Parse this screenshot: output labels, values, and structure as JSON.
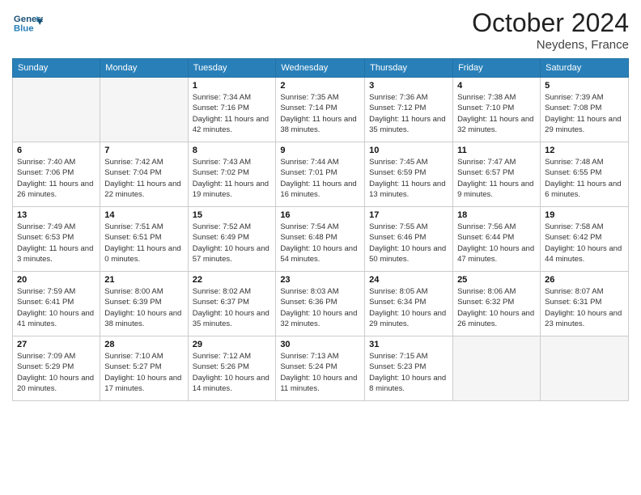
{
  "logo": {
    "general": "General",
    "blue": "Blue"
  },
  "header": {
    "month": "October 2024",
    "location": "Neydens, France"
  },
  "days_of_week": [
    "Sunday",
    "Monday",
    "Tuesday",
    "Wednesday",
    "Thursday",
    "Friday",
    "Saturday"
  ],
  "weeks": [
    [
      {
        "day": "",
        "info": ""
      },
      {
        "day": "",
        "info": ""
      },
      {
        "day": "1",
        "info": "Sunrise: 7:34 AM\nSunset: 7:16 PM\nDaylight: 11 hours and 42 minutes."
      },
      {
        "day": "2",
        "info": "Sunrise: 7:35 AM\nSunset: 7:14 PM\nDaylight: 11 hours and 38 minutes."
      },
      {
        "day": "3",
        "info": "Sunrise: 7:36 AM\nSunset: 7:12 PM\nDaylight: 11 hours and 35 minutes."
      },
      {
        "day": "4",
        "info": "Sunrise: 7:38 AM\nSunset: 7:10 PM\nDaylight: 11 hours and 32 minutes."
      },
      {
        "day": "5",
        "info": "Sunrise: 7:39 AM\nSunset: 7:08 PM\nDaylight: 11 hours and 29 minutes."
      }
    ],
    [
      {
        "day": "6",
        "info": "Sunrise: 7:40 AM\nSunset: 7:06 PM\nDaylight: 11 hours and 26 minutes."
      },
      {
        "day": "7",
        "info": "Sunrise: 7:42 AM\nSunset: 7:04 PM\nDaylight: 11 hours and 22 minutes."
      },
      {
        "day": "8",
        "info": "Sunrise: 7:43 AM\nSunset: 7:02 PM\nDaylight: 11 hours and 19 minutes."
      },
      {
        "day": "9",
        "info": "Sunrise: 7:44 AM\nSunset: 7:01 PM\nDaylight: 11 hours and 16 minutes."
      },
      {
        "day": "10",
        "info": "Sunrise: 7:45 AM\nSunset: 6:59 PM\nDaylight: 11 hours and 13 minutes."
      },
      {
        "day": "11",
        "info": "Sunrise: 7:47 AM\nSunset: 6:57 PM\nDaylight: 11 hours and 9 minutes."
      },
      {
        "day": "12",
        "info": "Sunrise: 7:48 AM\nSunset: 6:55 PM\nDaylight: 11 hours and 6 minutes."
      }
    ],
    [
      {
        "day": "13",
        "info": "Sunrise: 7:49 AM\nSunset: 6:53 PM\nDaylight: 11 hours and 3 minutes."
      },
      {
        "day": "14",
        "info": "Sunrise: 7:51 AM\nSunset: 6:51 PM\nDaylight: 11 hours and 0 minutes."
      },
      {
        "day": "15",
        "info": "Sunrise: 7:52 AM\nSunset: 6:49 PM\nDaylight: 10 hours and 57 minutes."
      },
      {
        "day": "16",
        "info": "Sunrise: 7:54 AM\nSunset: 6:48 PM\nDaylight: 10 hours and 54 minutes."
      },
      {
        "day": "17",
        "info": "Sunrise: 7:55 AM\nSunset: 6:46 PM\nDaylight: 10 hours and 50 minutes."
      },
      {
        "day": "18",
        "info": "Sunrise: 7:56 AM\nSunset: 6:44 PM\nDaylight: 10 hours and 47 minutes."
      },
      {
        "day": "19",
        "info": "Sunrise: 7:58 AM\nSunset: 6:42 PM\nDaylight: 10 hours and 44 minutes."
      }
    ],
    [
      {
        "day": "20",
        "info": "Sunrise: 7:59 AM\nSunset: 6:41 PM\nDaylight: 10 hours and 41 minutes."
      },
      {
        "day": "21",
        "info": "Sunrise: 8:00 AM\nSunset: 6:39 PM\nDaylight: 10 hours and 38 minutes."
      },
      {
        "day": "22",
        "info": "Sunrise: 8:02 AM\nSunset: 6:37 PM\nDaylight: 10 hours and 35 minutes."
      },
      {
        "day": "23",
        "info": "Sunrise: 8:03 AM\nSunset: 6:36 PM\nDaylight: 10 hours and 32 minutes."
      },
      {
        "day": "24",
        "info": "Sunrise: 8:05 AM\nSunset: 6:34 PM\nDaylight: 10 hours and 29 minutes."
      },
      {
        "day": "25",
        "info": "Sunrise: 8:06 AM\nSunset: 6:32 PM\nDaylight: 10 hours and 26 minutes."
      },
      {
        "day": "26",
        "info": "Sunrise: 8:07 AM\nSunset: 6:31 PM\nDaylight: 10 hours and 23 minutes."
      }
    ],
    [
      {
        "day": "27",
        "info": "Sunrise: 7:09 AM\nSunset: 5:29 PM\nDaylight: 10 hours and 20 minutes."
      },
      {
        "day": "28",
        "info": "Sunrise: 7:10 AM\nSunset: 5:27 PM\nDaylight: 10 hours and 17 minutes."
      },
      {
        "day": "29",
        "info": "Sunrise: 7:12 AM\nSunset: 5:26 PM\nDaylight: 10 hours and 14 minutes."
      },
      {
        "day": "30",
        "info": "Sunrise: 7:13 AM\nSunset: 5:24 PM\nDaylight: 10 hours and 11 minutes."
      },
      {
        "day": "31",
        "info": "Sunrise: 7:15 AM\nSunset: 5:23 PM\nDaylight: 10 hours and 8 minutes."
      },
      {
        "day": "",
        "info": ""
      },
      {
        "day": "",
        "info": ""
      }
    ]
  ]
}
